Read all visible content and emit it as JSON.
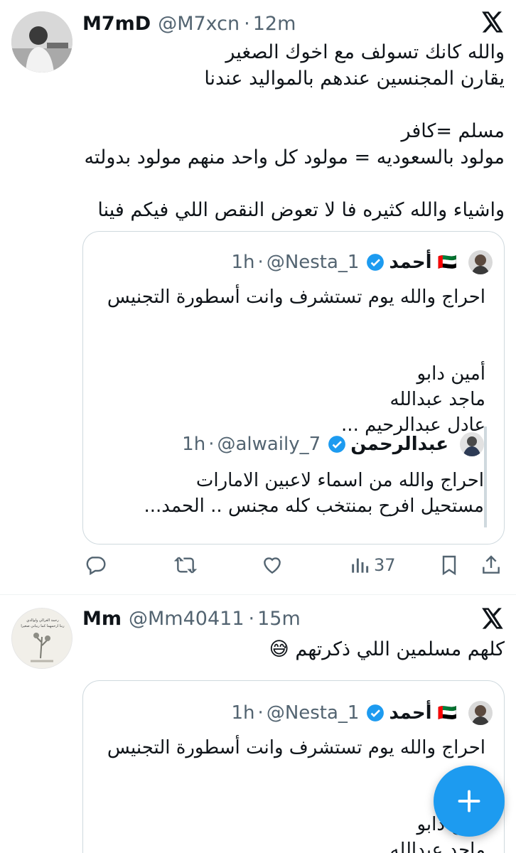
{
  "tweets": [
    {
      "name": "M7mD",
      "handle": "@M7xcn",
      "time_sep": "·",
      "time": "12m",
      "text": "والله كانك تسولف مع اخوك الصغير\nيقارن المجنسين عندهم بالمواليد عندنا\n\nمسلم =كافر\nمولود بالسعوديه = مولود كل واحد منهم مولود بدولته\n\nواشياء والله كثيره فا لا تعوض النقص اللي فيكم فينا",
      "quote": {
        "name": "أحمد",
        "flag": "🇦🇪",
        "handle": "@Nesta_1",
        "time": "1h",
        "text": "احراج والله يوم تستشرف وانت أسطورة التجنيس\n\n\nأمين دابو\nماجد عبدالله\nعادل عبدالرحيم ...",
        "nested": {
          "name": "عبدالرحمن",
          "handle": "@alwaily_7",
          "time": "1h",
          "text": "احراج والله من اسماء لاعبين الامارات\nمستحيل افرح بمنتخب كله مجنس .. الحمد..."
        }
      },
      "actions": {
        "views": "37"
      }
    },
    {
      "name": "Mm",
      "handle": "@Mm40411",
      "time_sep": "·",
      "time": "15m",
      "text": "كلهم مسلمين اللي ذكرتهم 😅",
      "avatar_caption_1": "رحمة الغرالي ولوالدي",
      "avatar_caption_2": "ربنا ارحمهما كما ربياني صغيرا",
      "quote": {
        "name": "أحمد",
        "flag": "🇦🇪",
        "handle": "@Nesta_1",
        "time": "1h",
        "text": "احراج والله يوم تستشرف وانت أسطورة التجنيس\n\n\nأمين دابو\nماجد عبدالله\nعادل عبدالرحيم ..."
      }
    }
  ],
  "colors": {
    "accent": "#1d9bf0",
    "secondary_text": "#536471",
    "border": "#cfd9de"
  },
  "icons": [
    "x-logo-icon",
    "verified-badge-icon",
    "reply-icon",
    "retweet-icon",
    "like-icon",
    "views-icon",
    "bookmark-icon",
    "share-icon",
    "plus-icon"
  ]
}
